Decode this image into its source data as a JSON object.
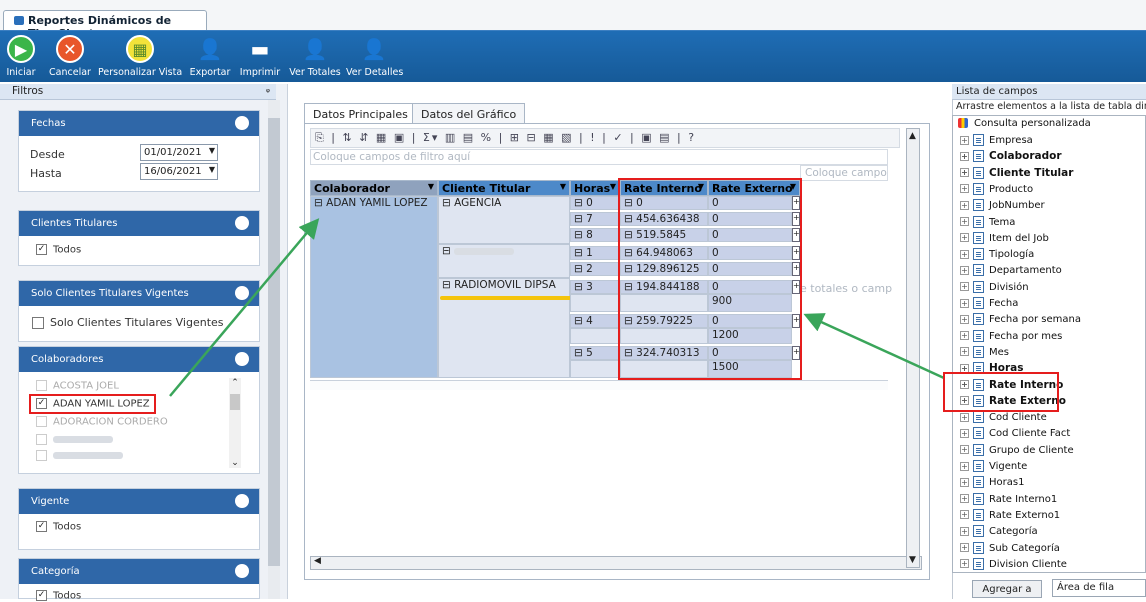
{
  "window": {
    "tab_title": "Reportes Dinámicos de TimeSheet"
  },
  "ribbon": {
    "buttons": [
      {
        "label": "Iniciar",
        "icon": "play-icon",
        "color": "#3bb54a"
      },
      {
        "label": "Cancelar",
        "icon": "cancel-icon",
        "color": "#e8562a"
      },
      {
        "label": "Personalizar Vista",
        "icon": "grid-globe-icon",
        "color": "#f2e23a"
      },
      {
        "label": "Exportar",
        "icon": "user-export-icon",
        "color": "#ffffff"
      },
      {
        "label": "Imprimir",
        "icon": "printer-icon",
        "color": "#ffffff"
      },
      {
        "label": "Ver Totales",
        "icon": "user-totals-icon",
        "color": "#ffffff"
      },
      {
        "label": "Ver Detalles",
        "icon": "user-details-icon",
        "color": "#ffffff"
      }
    ]
  },
  "filters": {
    "title": "Filtros",
    "fechas": {
      "title": "Fechas",
      "desde_label": "Desde",
      "desde_value": "01/01/2021",
      "hasta_label": "Hasta",
      "hasta_value": "16/06/2021"
    },
    "clientes": {
      "title": "Clientes Titulares",
      "todos": "Todos"
    },
    "vigentes": {
      "title": "Solo Clientes Titulares Vigentes",
      "option": "Solo Clientes Titulares Vigentes"
    },
    "colaboradores": {
      "title": "Colaboradores",
      "items": [
        "ACOSTA JOEL",
        "ADAN YAMIL LOPEZ",
        "ADORACION CORDERO"
      ]
    },
    "vigente": {
      "title": "Vigente",
      "todos": "Todos"
    },
    "categoria": {
      "title": "Categoría",
      "todos": "Todos"
    }
  },
  "center": {
    "tabs": [
      "Datos Principales",
      "Datos del Gráfico"
    ],
    "filter_zone": "Coloque campos de filtro aquí",
    "column_zone": "Coloque campos",
    "side_hint": "e totales o camp",
    "headers": [
      "Colaborador",
      "Cliente Titular",
      "Horas",
      "Rate Interno",
      "Rate Externo"
    ],
    "colaborador": "⊟ ADAN YAMIL LOPEZ",
    "cliente1": "⊟ AGENCIA",
    "cliente3": "⊟ RADIOMOVIL DIPSA",
    "rows": [
      {
        "horas": "⊟ 0",
        "interno": "⊟ 0",
        "externo": "0"
      },
      {
        "horas": "⊟ 7",
        "interno": "⊟ 454.636438",
        "externo": "0"
      },
      {
        "horas": "⊟ 8",
        "interno": "⊟ 519.5845",
        "externo": "0"
      },
      {
        "horas": "⊟ 1",
        "interno": "⊟ 64.948063",
        "externo": "0"
      },
      {
        "horas": "⊟ 2",
        "interno": "⊟ 129.896125",
        "externo": "0"
      },
      {
        "horas": "⊟ 3",
        "interno": "⊟ 194.844188",
        "externo": "0",
        "externo2": "900"
      },
      {
        "horas": "⊟ 4",
        "interno": "⊟ 259.79225",
        "externo": "0",
        "externo2": "1200"
      },
      {
        "horas": "⊟ 5",
        "interno": "⊟ 324.740313",
        "externo": "0",
        "externo2": "1500"
      }
    ]
  },
  "fieldlist": {
    "title": "Lista de campos",
    "hint": "Arrastre elementos a la lista de tabla dinám",
    "root": "Consulta personalizada",
    "items": [
      "Empresa",
      "Colaborador",
      "Cliente Titular",
      "Producto",
      "JobNumber",
      "Tema",
      "Item del Job",
      "Tipología",
      "Departamento",
      "División",
      "Fecha",
      "Fecha por semana",
      "Fecha por mes",
      "Mes",
      "Horas",
      "Rate Interno",
      "Rate Externo",
      "Cod Cliente",
      "Cod Cliente Fact",
      "Grupo de Cliente",
      "Vigente",
      "Horas1",
      "Rate Interno1",
      "Rate Externo1",
      "Categoría",
      "Sub Categoría",
      "Division Cliente"
    ],
    "add_button": "Agregar a",
    "area_value": "Área de fila"
  }
}
